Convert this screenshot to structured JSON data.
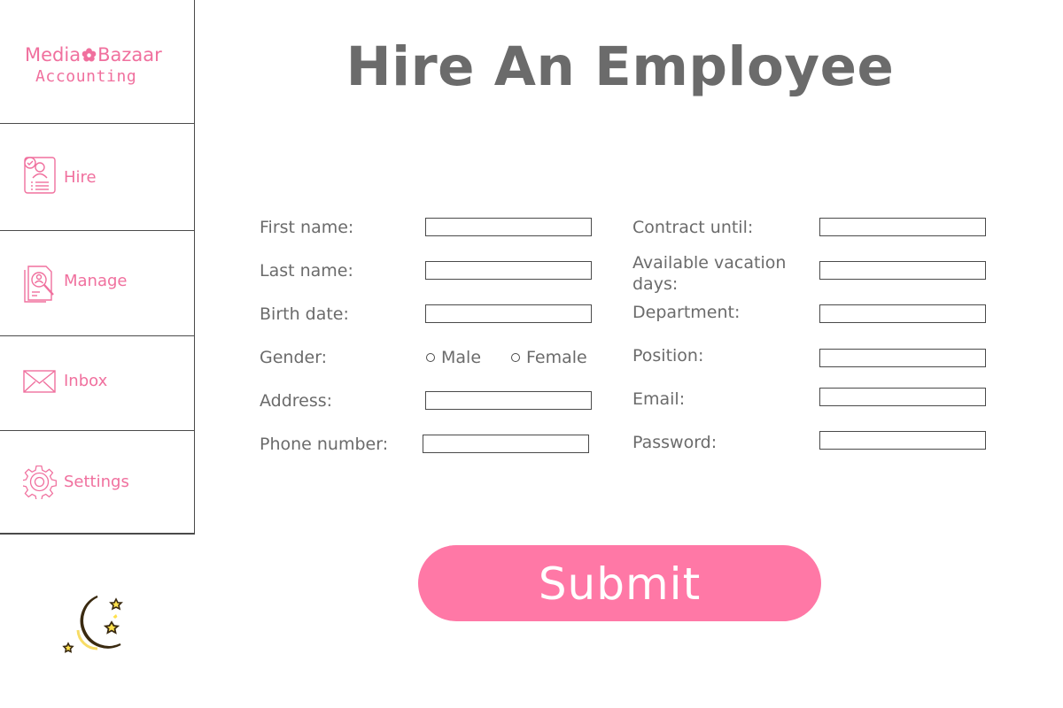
{
  "brand": {
    "line1_a": "Media",
    "line1_b": "Bazaar",
    "line2": "Accounting",
    "color": "#f0709e"
  },
  "nav": {
    "items": [
      {
        "label": "Hire",
        "icon": "hire-cv-icon"
      },
      {
        "label": "Manage",
        "icon": "manage-search-icon"
      },
      {
        "label": "Inbox",
        "icon": "envelope-icon"
      },
      {
        "label": "Settings",
        "icon": "gear-icon"
      }
    ]
  },
  "theme_toggle": {
    "icon": "moon-stars-icon"
  },
  "page": {
    "title": "Hire An Employee"
  },
  "form": {
    "left": {
      "first_name": {
        "label": "First name:",
        "value": ""
      },
      "last_name": {
        "label": "Last name:",
        "value": ""
      },
      "birth_date": {
        "label": "Birth date:",
        "value": ""
      },
      "gender": {
        "label": "Gender:",
        "options": [
          "Male",
          "Female"
        ],
        "selected": null
      },
      "address": {
        "label": "Address:",
        "value": ""
      },
      "phone": {
        "label": "Phone number:",
        "value": ""
      }
    },
    "right": {
      "contract_until": {
        "label": "Contract until:",
        "value": ""
      },
      "vacation_days": {
        "label": "Available vacation days:",
        "value": ""
      },
      "department": {
        "label": "Department:",
        "value": ""
      },
      "position": {
        "label": "Position:",
        "value": ""
      },
      "email": {
        "label": "Email:",
        "value": ""
      },
      "password": {
        "label": "Password:",
        "value": ""
      }
    },
    "submit_label": "Submit"
  },
  "colors": {
    "accent": "#ff78a6",
    "text": "#6b6b6b",
    "border": "#4a4a4a",
    "moon": "#ffe14d"
  }
}
